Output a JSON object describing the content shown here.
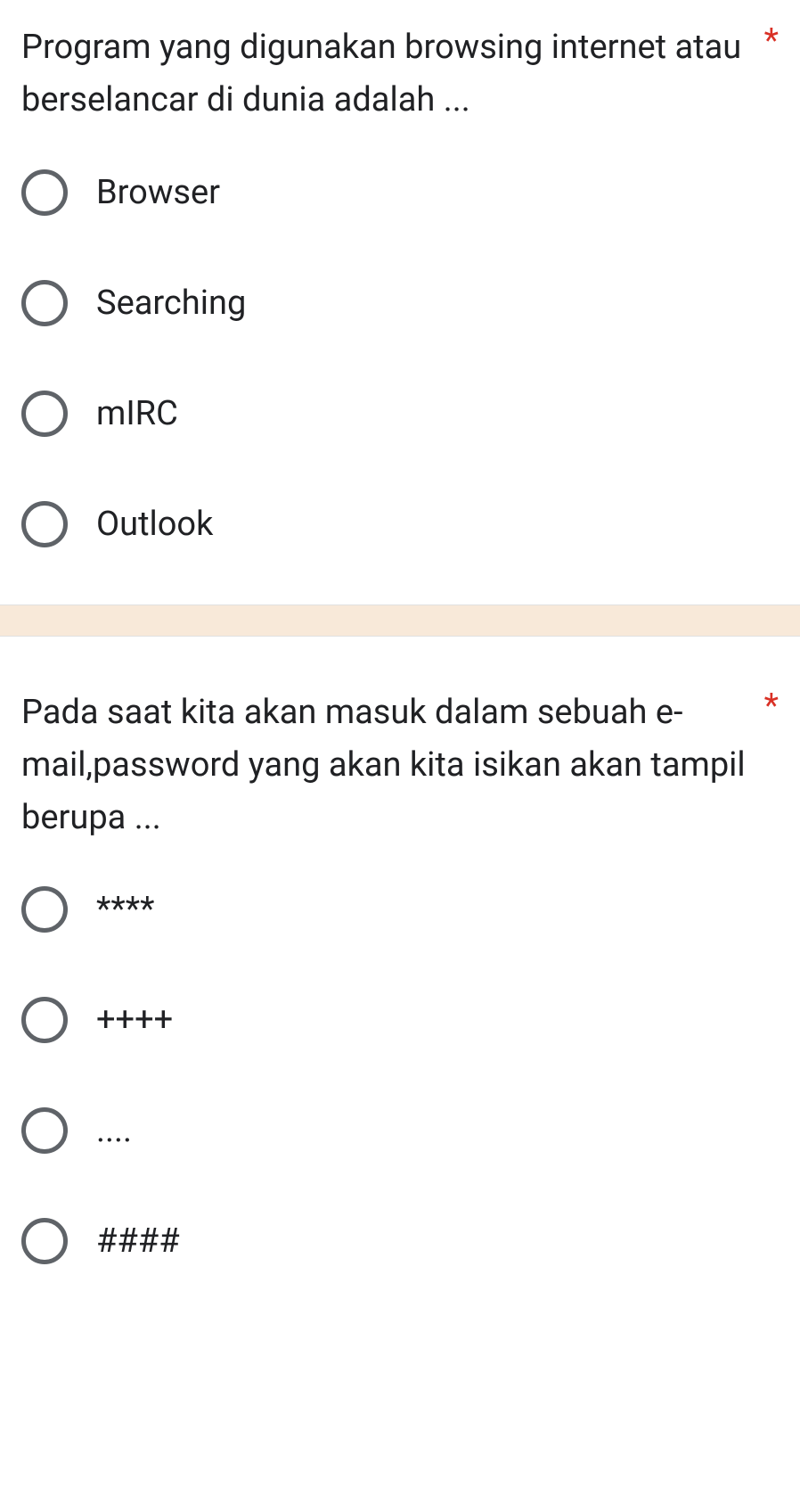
{
  "questions": [
    {
      "text": "Program yang digunakan browsing internet atau berselancar di dunia adalah ...",
      "required": "*",
      "options": [
        "Browser",
        "Searching",
        "mIRC",
        "Outlook"
      ]
    },
    {
      "text": "Pada saat kita akan masuk dalam sebuah e-mail,password yang akan kita isikan akan tampil berupa ...",
      "required": "*",
      "options": [
        "****",
        "++++",
        "....",
        "####"
      ]
    }
  ]
}
